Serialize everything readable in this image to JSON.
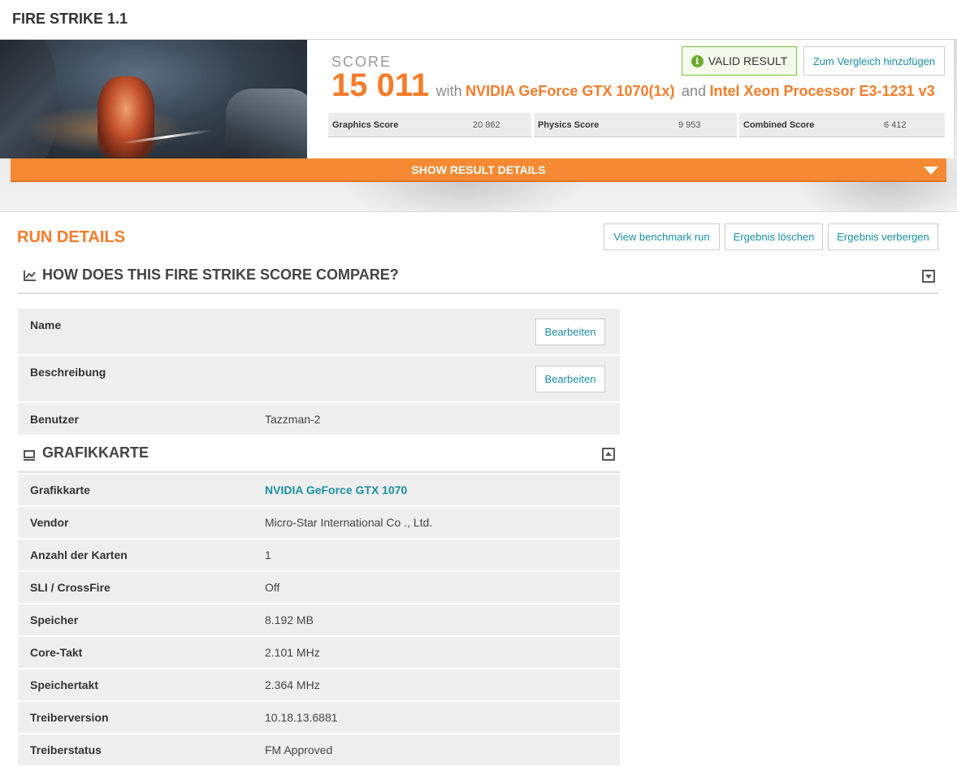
{
  "header": {
    "title": "FIRE STRIKE 1.1"
  },
  "score": {
    "label": "SCORE",
    "value": "15 011",
    "with_text": "with",
    "gpu": "NVIDIA GeForce GTX 1070(1x)",
    "and_text": "and",
    "cpu": "Intel Xeon Processor E3-1231 v3",
    "valid_label": "VALID RESULT",
    "compare_label": "Zum Vergleich hinzufügen",
    "subscores": [
      {
        "label": "Graphics Score",
        "value": "20 862"
      },
      {
        "label": "Physics Score",
        "value": "9 953"
      },
      {
        "label": "Combined Score",
        "value": "6 412"
      }
    ]
  },
  "details_bar": {
    "label": "SHOW RESULT DETAILS"
  },
  "run": {
    "title": "RUN DETAILS",
    "buttons": {
      "view": "View benchmark run",
      "delete": "Ergebnis löschen",
      "hide": "Ergebnis verbergen"
    },
    "compare_heading": "HOW DOES THIS FIRE STRIKE SCORE COMPARE?",
    "edit_label": "Bearbeiten",
    "info_rows": [
      {
        "key": "Name",
        "value": ""
      },
      {
        "key": "Beschreibung",
        "value": ""
      },
      {
        "key": "Benutzer",
        "value": "Tazzman-2"
      }
    ]
  },
  "gpu_section": {
    "heading": "GRAFIKKARTE",
    "rows": [
      {
        "key": "Grafikkarte",
        "value": "NVIDIA GeForce GTX 1070"
      },
      {
        "key": "Vendor",
        "value": "Micro-Star International Co ., Ltd."
      },
      {
        "key": "Anzahl der Karten",
        "value": "1"
      },
      {
        "key": "SLI / CrossFire",
        "value": "Off"
      },
      {
        "key": "Speicher",
        "value": "8.192 MB"
      },
      {
        "key": "Core-Takt",
        "value": "2.101 MHz"
      },
      {
        "key": "Speichertakt",
        "value": "2.364 MHz"
      },
      {
        "key": "Treiberversion",
        "value": "10.18.13.6881"
      },
      {
        "key": "Treiberstatus",
        "value": "FM Approved"
      }
    ]
  },
  "colors": {
    "accent": "#f47c2a",
    "link": "#1a8fa6",
    "valid": "#6aab2d"
  }
}
